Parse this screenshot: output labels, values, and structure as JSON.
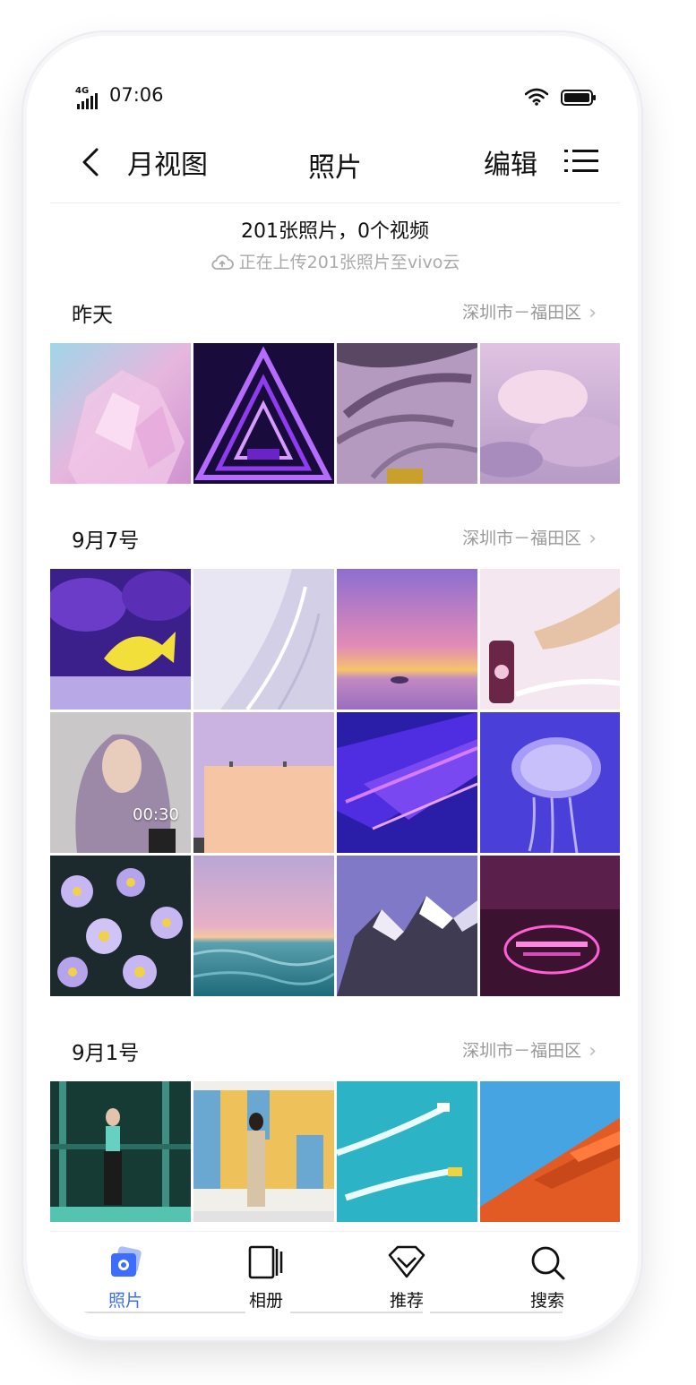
{
  "status": {
    "network": "4G",
    "time": "07:06"
  },
  "header": {
    "back_label": "月视图",
    "title": "照片",
    "edit_label": "编辑"
  },
  "summary": {
    "counts": "201张照片，0个视频",
    "upload": "正在上传201张照片至vivo云"
  },
  "sections": [
    {
      "date": "昨天",
      "location": "深圳市－福田区"
    },
    {
      "date": "9月7号",
      "location": "深圳市－福田区"
    },
    {
      "date": "9月1号",
      "location": "深圳市－福田区"
    }
  ],
  "video": {
    "duration": "00:30"
  },
  "tabs": [
    {
      "label": "照片",
      "icon": "photos-icon",
      "active": true
    },
    {
      "label": "相册",
      "icon": "album-icon",
      "active": false
    },
    {
      "label": "推荐",
      "icon": "recommend-icon",
      "active": false
    },
    {
      "label": "搜索",
      "icon": "search-icon",
      "active": false
    }
  ],
  "colors": {
    "accent": "#3f6dfb",
    "text": "#111111",
    "muted": "#999999"
  }
}
